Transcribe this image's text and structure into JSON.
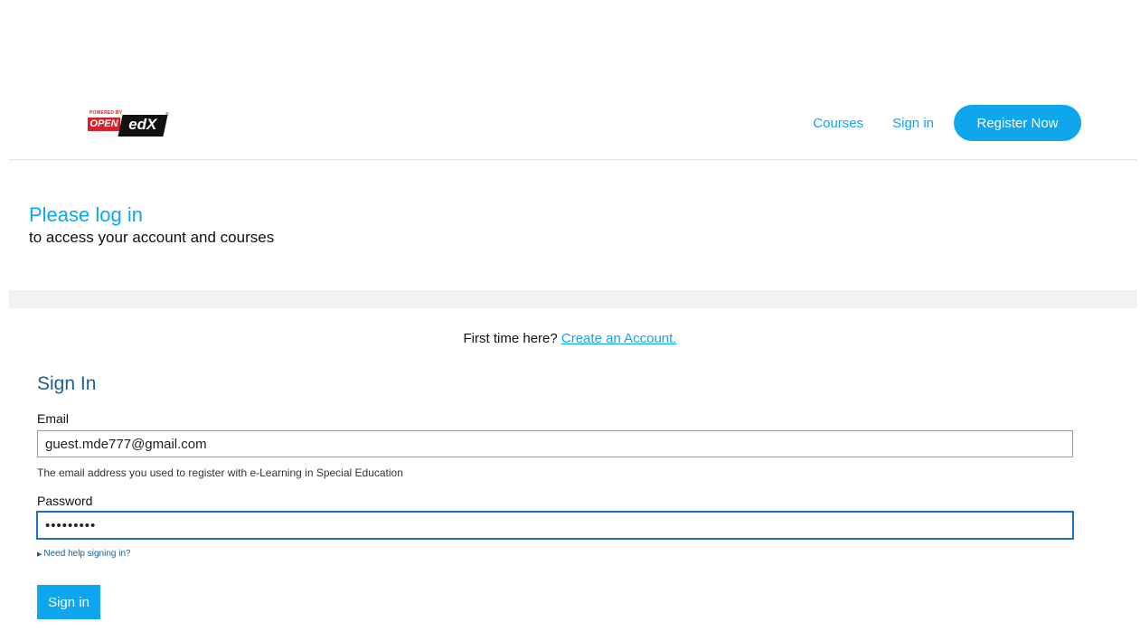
{
  "header": {
    "logo": {
      "powered_text": "POWERED BY",
      "open_text": "OPEN",
      "edx_text": "edX",
      "reg_mark": "®"
    },
    "nav": {
      "courses_label": "Courses",
      "signin_label": "Sign in",
      "register_label": "Register Now"
    }
  },
  "intro": {
    "title": "Please log in",
    "subtitle": "to access your account and courses"
  },
  "first_time": {
    "prompt": "First time here?",
    "link_text": "Create an Account."
  },
  "form": {
    "title": "Sign In",
    "email_label": "Email",
    "email_value": "guest.mde777@gmail.com",
    "email_hint": "The email address you used to register with e-Learning in Special Education",
    "password_label": "Password",
    "password_value": "•••••••••",
    "help_link": "Need help signing in?",
    "submit_label": "Sign in"
  },
  "colors": {
    "accent": "#0ea6ec",
    "title_dark": "#1f5f8b",
    "focus_border": "#1a73c9"
  }
}
